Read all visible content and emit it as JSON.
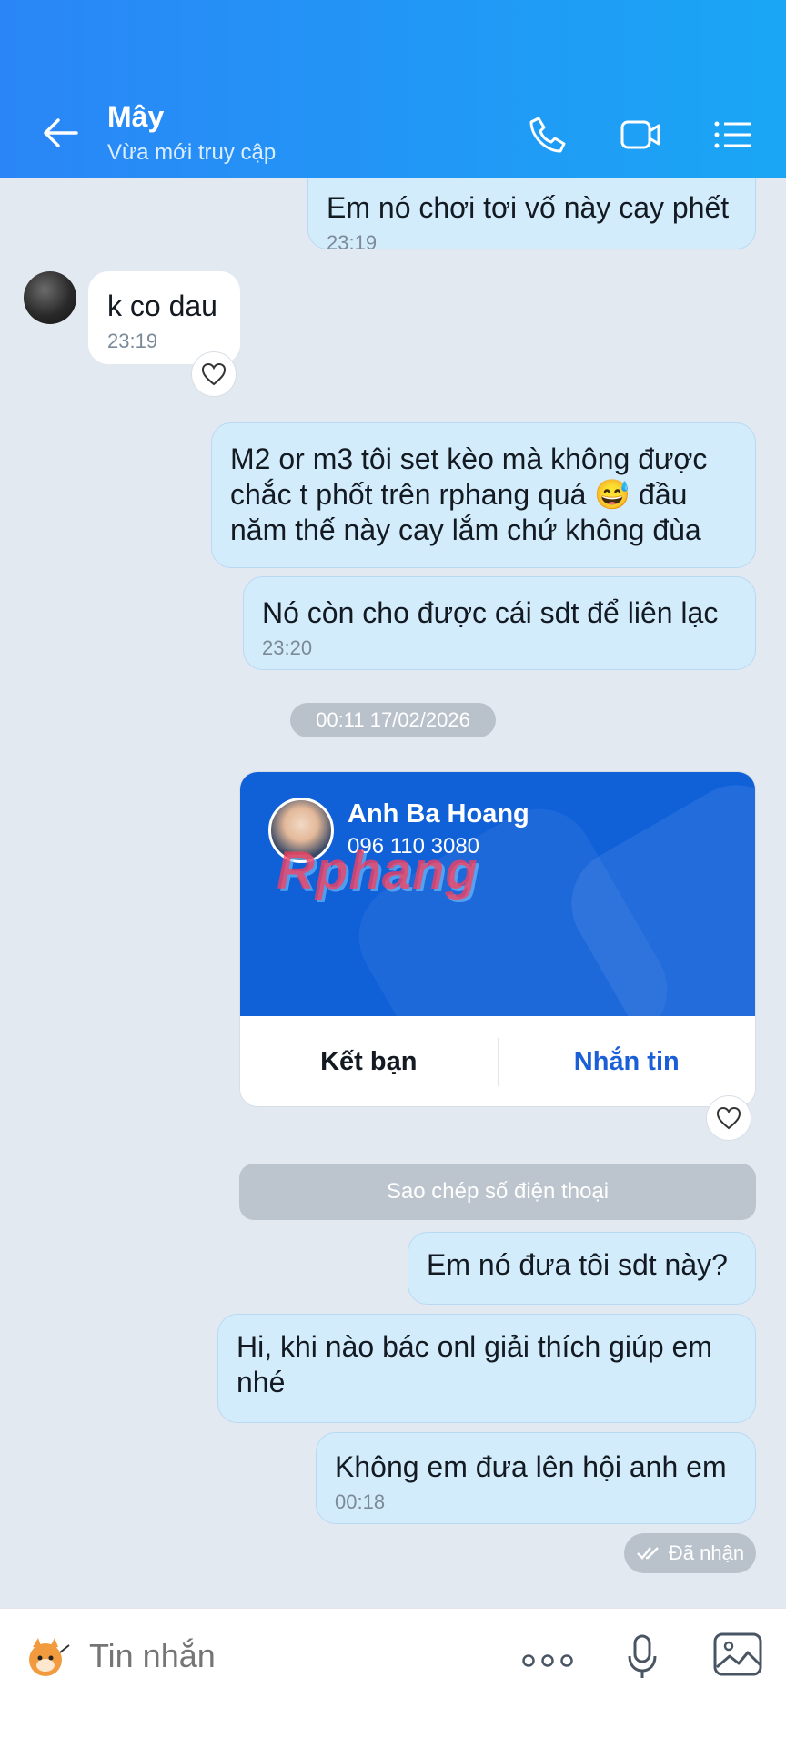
{
  "header": {
    "title": "Mây",
    "subtitle": "Vừa mới truy cập"
  },
  "messages": [
    {
      "text": "Em nó chơi tơi vố này cay phết",
      "time": "23:19"
    },
    {
      "text": "k co dau",
      "time": "23:19"
    },
    {
      "text": "M2 or m3 tôi set kèo mà không được chắc t phốt trên rphang quá 😅 đầu năm thế này cay lắm chứ không đùa"
    },
    {
      "text": "Nó còn cho được cái sdt để liên lạc",
      "time": "23:20"
    },
    {
      "text": "Em nó đưa tôi sdt này?"
    },
    {
      "text": "Hi, khi nào bác onl giải thích giúp em nhé"
    },
    {
      "text": "Không em đưa lên hội anh em",
      "time": "00:18"
    }
  ],
  "date_separator": "00:11 17/02/2026",
  "contact_card": {
    "name": "Anh Ba Hoang",
    "phone": "096 110 3080",
    "watermark": "Rphang",
    "add_friend": "Kết bạn",
    "message": "Nhắn tin"
  },
  "copy_phone_label": "Sao chép số điện thoại",
  "status_label": "Đã nhận",
  "input": {
    "placeholder": "Tin nhắn"
  },
  "colors": {
    "header_start": "#2a86f6",
    "header_end": "#1aa6f5",
    "outgoing_bubble": "#d3ecfc",
    "card_blue": "#1060d8",
    "link_blue": "#1a5fd6"
  }
}
